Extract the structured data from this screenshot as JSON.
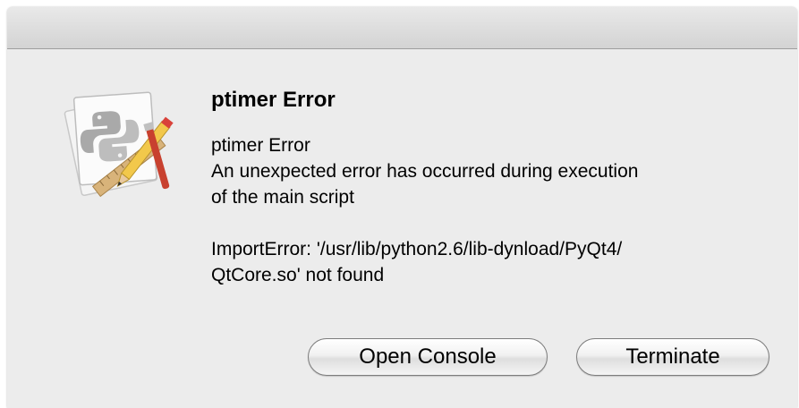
{
  "dialog": {
    "title": "ptimer Error",
    "message_heading": "ptimer Error",
    "message_line1": "An unexpected error has occurred during execution",
    "message_line2": "of the main script",
    "error_line1": "ImportError: '/usr/lib/python2.6/lib-dynload/PyQt4/",
    "error_line2": "QtCore.so' not found",
    "icon": "python-launcher-icon"
  },
  "buttons": {
    "open_console": "Open Console",
    "terminate": "Terminate"
  }
}
